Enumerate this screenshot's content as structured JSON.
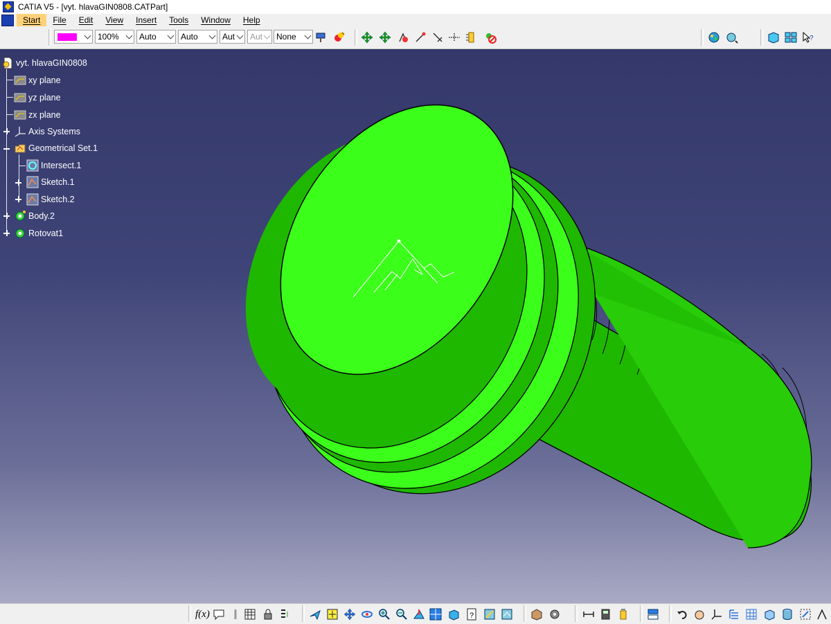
{
  "window": {
    "title": "CATIA V5 - [vyt. hlavaGIN0808.CATPart]"
  },
  "menu": [
    {
      "label": "Start",
      "active": true
    },
    {
      "label": "File"
    },
    {
      "label": "Edit"
    },
    {
      "label": "View"
    },
    {
      "label": "Insert"
    },
    {
      "label": "Tools"
    },
    {
      "label": "Window"
    },
    {
      "label": "Help"
    }
  ],
  "toolbar": {
    "color_value": "#ff00ff",
    "transparency": "100%",
    "line_thickness": "Auto",
    "line_type": "Auto",
    "point_symbol": "Aut",
    "rendering_style": "Aut",
    "layer": "None"
  },
  "tree": {
    "root": "vyt. hlavaGIN0808",
    "items": [
      {
        "label": "xy plane",
        "icon": "plane-icon"
      },
      {
        "label": "yz plane",
        "icon": "plane-icon"
      },
      {
        "label": "zx plane",
        "icon": "plane-icon"
      },
      {
        "label": "Axis Systems",
        "icon": "axis-system-icon"
      },
      {
        "label": "Geometrical Set.1",
        "icon": "geometrical-set-icon"
      },
      {
        "label": "Intersect.1",
        "icon": "intersect-icon"
      },
      {
        "label": "Sketch.1",
        "icon": "sketch-icon"
      },
      {
        "label": "Sketch.2",
        "icon": "sketch-icon"
      },
      {
        "label": "Body.2",
        "icon": "body-icon"
      },
      {
        "label": "Rotovat1",
        "icon": "body-icon"
      }
    ]
  },
  "colors": {
    "part_light": "#3bff1a",
    "part_mid": "#2ee010",
    "part_dark": "#1ca800",
    "viewport_top": "#34386a",
    "viewport_bottom": "#a9aac4"
  },
  "bottom_toolbar": {
    "formula_label": "f(x)"
  }
}
